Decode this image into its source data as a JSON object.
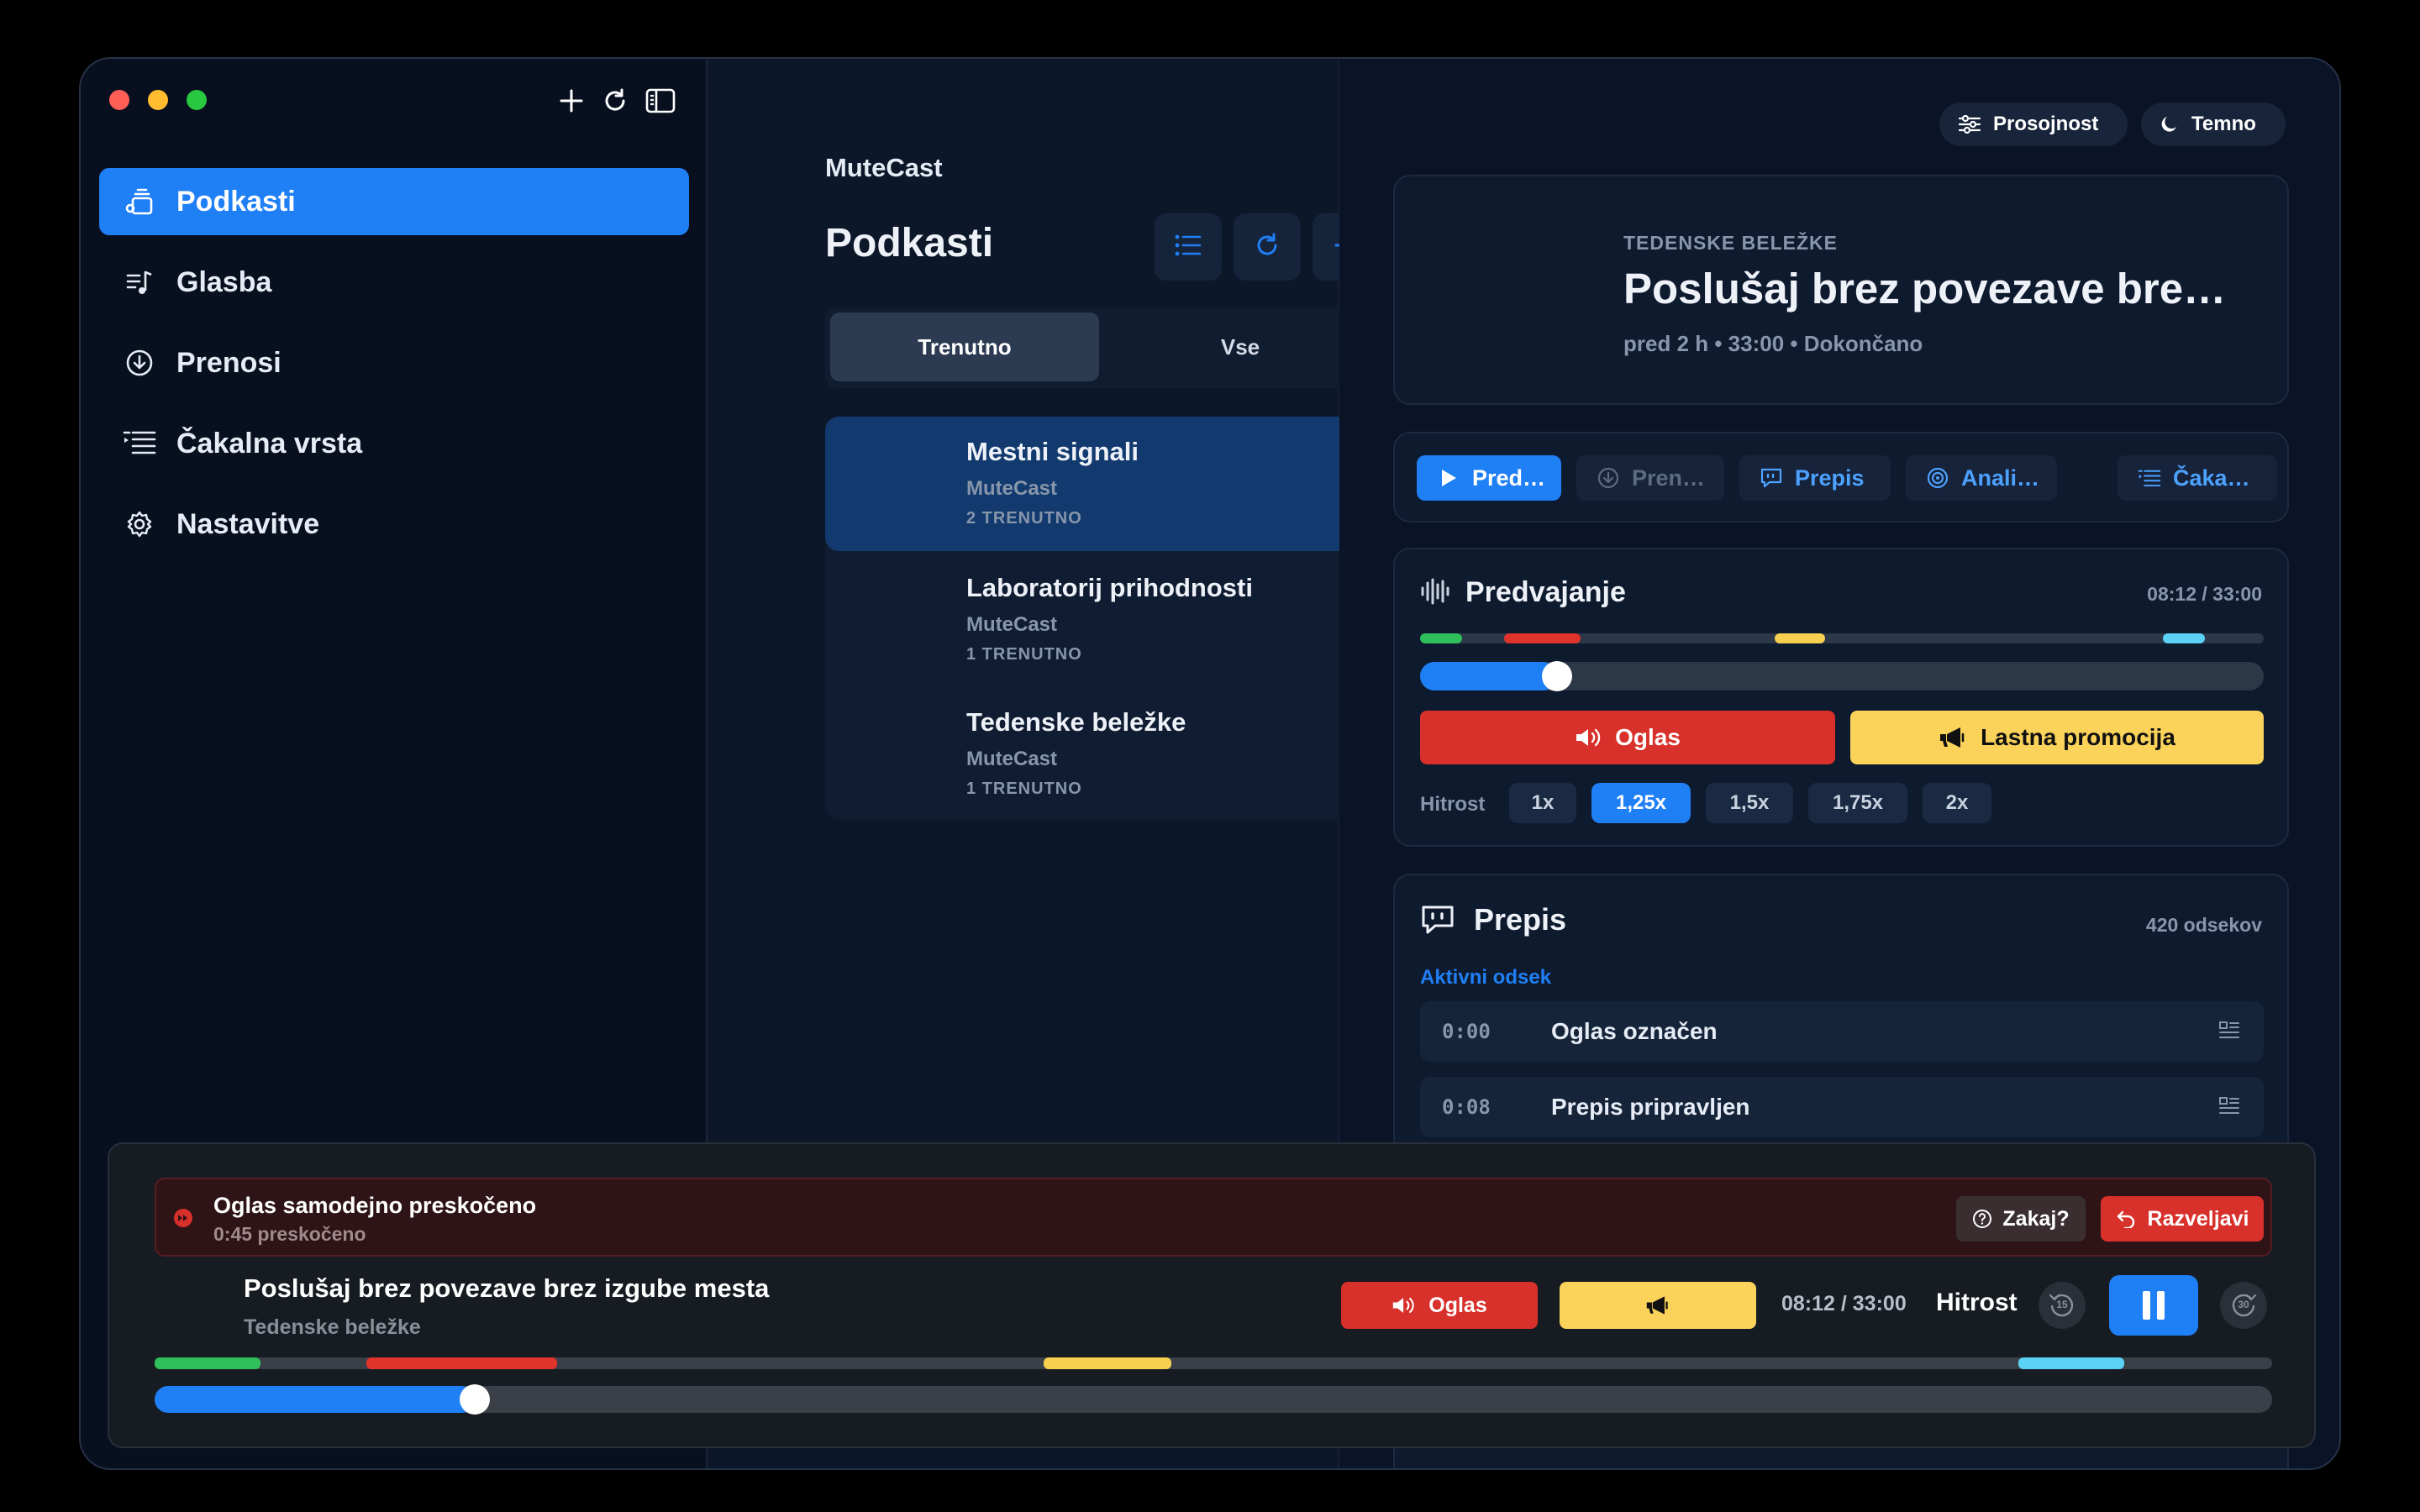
{
  "sidebar": {
    "items": [
      {
        "label": "Podkasti",
        "icon": "podcasts-icon",
        "active": true
      },
      {
        "label": "Glasba",
        "icon": "music-icon",
        "active": false
      },
      {
        "label": "Prenosi",
        "icon": "download-icon",
        "active": false
      },
      {
        "label": "Čakalna vrsta",
        "icon": "queue-icon",
        "active": false
      },
      {
        "label": "Nastavitve",
        "icon": "gear-icon",
        "active": false
      }
    ]
  },
  "middle": {
    "app_name": "MuteCast",
    "title": "Podkasti",
    "segments": [
      "Trenutno",
      "Vse"
    ],
    "podcasts": [
      {
        "title": "Mestni signali",
        "author": "MuteCast",
        "count": "2 TRENUTNO"
      },
      {
        "title": "Laboratorij prihodnosti",
        "author": "MuteCast",
        "count": "1 TRENUTNO"
      },
      {
        "title": "Tedenske beležke",
        "author": "MuteCast",
        "count": "1 TRENUTNO"
      }
    ]
  },
  "header": {
    "transparency_label": "Prosojnost",
    "theme_label": "Temno"
  },
  "episode": {
    "show": "TEDENSKE BELEŽKE",
    "title": "Poslušaj brez povezave bre…",
    "meta": "pred 2 h • 33:00 • Dokončano"
  },
  "tabs": {
    "play": "Pred…",
    "download": "Pren…",
    "transcript": "Prepis",
    "analysis": "Anali…",
    "queue": "Čaka…"
  },
  "playback": {
    "title": "Predvajanje",
    "time": "08:12 / 33:00",
    "progress": 0.2485,
    "segments": [
      {
        "type": "intro",
        "start": 0.0,
        "end": 0.05,
        "color": "#2fbf5b"
      },
      {
        "type": "ad",
        "start": 0.1,
        "end": 0.19,
        "color": "#e0332b"
      },
      {
        "type": "promo",
        "start": 0.42,
        "end": 0.48,
        "color": "#f7d050"
      },
      {
        "type": "outro",
        "start": 0.88,
        "end": 0.93,
        "color": "#5ad1f5"
      }
    ],
    "ad_label": "Oglas",
    "promo_label": "Lastna promocija",
    "speed_label": "Hitrost",
    "speeds": [
      "1x",
      "1,25x",
      "1,5x",
      "1,75x",
      "2x"
    ],
    "active_speed": "1,25x"
  },
  "transcript": {
    "title": "Prepis",
    "count": "420 odsekov",
    "active_label": "Aktivni odsek",
    "rows": [
      {
        "time": "0:00",
        "text": "Oglas označen"
      },
      {
        "time": "0:08",
        "text": "Prepis pripravljen"
      }
    ]
  },
  "player": {
    "toast_title": "Oglas samodejno preskočeno",
    "toast_sub": "0:45 preskočeno",
    "why_label": "Zakaj?",
    "undo_label": "Razveljavi",
    "title": "Poslušaj brez povezave brez izgube mesta",
    "subtitle": "Tedenske beležke",
    "ad_label": "Oglas",
    "time": "08:12 / 33:00",
    "speed_label": "Hitrost",
    "skip_back": "15",
    "skip_forward": "30"
  },
  "colors": {
    "accent": "#1f7ff5",
    "ad": "#e0332b",
    "promo": "#f7d050",
    "intro": "#2fbf5b",
    "outro": "#5ad1f5"
  }
}
